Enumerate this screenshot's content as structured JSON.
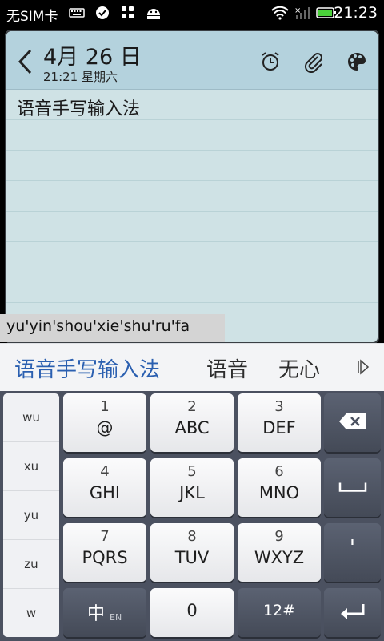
{
  "status_bar": {
    "carrier": "无SIM卡",
    "time": "21:23",
    "icons": [
      "keyboard-icon",
      "check-circle-icon",
      "apps-icon",
      "android-icon",
      "wifi-icon",
      "no-signal-icon",
      "battery-icon"
    ]
  },
  "note": {
    "date": "4月 26 日",
    "datetime": "21:21 星期六",
    "text": "语音手写输入法",
    "header_icons": [
      "back-icon",
      "alarm-icon",
      "attachment-icon",
      "palette-icon"
    ]
  },
  "ime": {
    "composing": "yu'yin'shou'xie'shu'ru'fa",
    "candidates": [
      "语音手写输入法",
      "语音",
      "无心"
    ],
    "pinyin_options": [
      "wu",
      "xu",
      "yu",
      "zu",
      "w"
    ],
    "keys": [
      {
        "num": "1",
        "label": "@"
      },
      {
        "num": "2",
        "label": "ABC"
      },
      {
        "num": "3",
        "label": "DEF"
      },
      {
        "num": "4",
        "label": "GHI"
      },
      {
        "num": "5",
        "label": "JKL"
      },
      {
        "num": "6",
        "label": "MNO"
      },
      {
        "num": "7",
        "label": "PQRS"
      },
      {
        "num": "8",
        "label": "TUV"
      },
      {
        "num": "9",
        "label": "WXYZ"
      }
    ],
    "bottom": {
      "lang_main": "中",
      "lang_sub": "EN",
      "zero": "0",
      "symbols": "12#",
      "apostrophe": "'"
    }
  },
  "colors": {
    "note_bg": "#cfe2e5",
    "note_header": "#b4d2dd",
    "candidate_highlight": "#2a5fb0",
    "keyboard_bg": "#4b5160"
  }
}
